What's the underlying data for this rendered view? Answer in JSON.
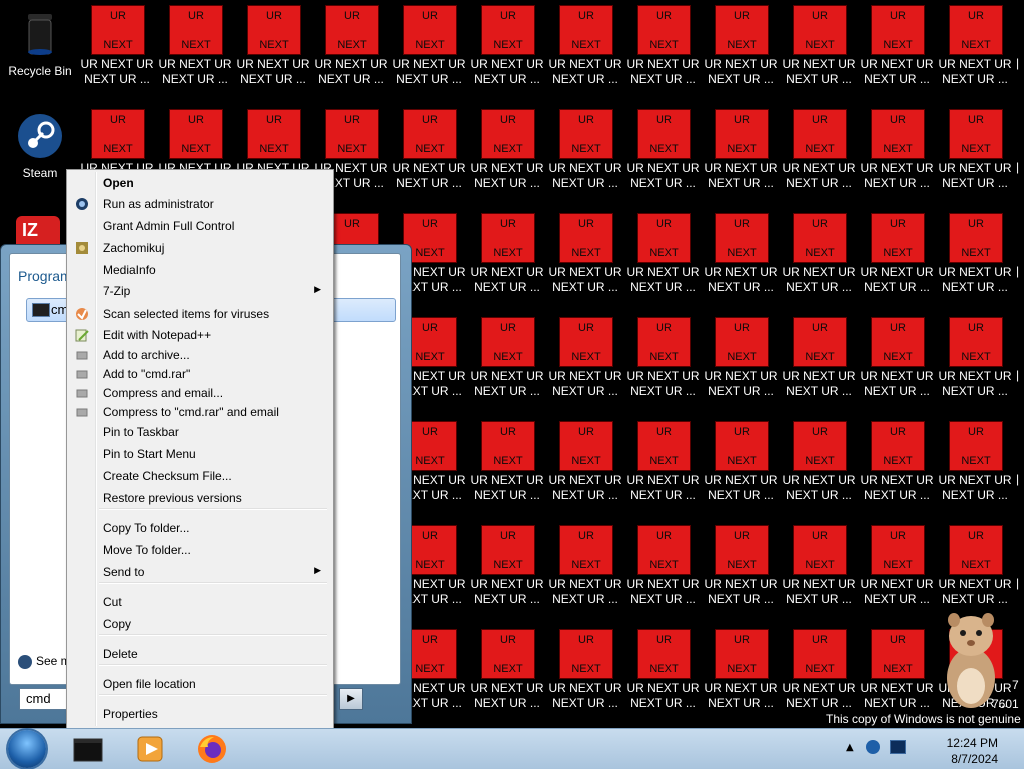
{
  "desktop": {
    "tile_top_text": "UR",
    "tile_bottom_text": "NEXT",
    "tile_caption_line1": "UR NEXT UR",
    "tile_caption_line2": "NEXT UR ...",
    "tile_color": "#e1191a",
    "system_icons": [
      {
        "label": "Recycle Bin",
        "icon": "recycle-bin-icon"
      },
      {
        "label": "Steam",
        "icon": "steam-icon"
      }
    ]
  },
  "start_menu": {
    "programs_label": "Programs",
    "result_label": "cmd",
    "see_more": "See more results",
    "search_value": "cmd"
  },
  "context_menu": {
    "items": [
      {
        "label": "Open",
        "bold": true
      },
      {
        "label": "Run as administrator",
        "icon": "shield-icon"
      },
      {
        "label": "Grant Admin Full Control"
      },
      {
        "label": "Zachomikuj",
        "icon": "hamster-icon"
      },
      {
        "label": "MediaInfo"
      },
      {
        "label": "7-Zip",
        "submenu": true
      },
      {
        "label": "Scan selected items for viruses",
        "icon": "antivirus-icon"
      },
      {
        "label": "Edit with Notepad++",
        "icon": "notepadpp-icon"
      },
      {
        "label": "Add to archive...",
        "icon": "archive-icon"
      },
      {
        "label": "Add to \"cmd.rar\"",
        "icon": "archive-icon"
      },
      {
        "label": "Compress and email...",
        "icon": "archive-icon"
      },
      {
        "label": "Compress to \"cmd.rar\" and email",
        "icon": "archive-icon"
      },
      {
        "label": "Pin to Taskbar"
      },
      {
        "label": "Pin to Start Menu"
      },
      {
        "label": "Create Checksum File..."
      },
      {
        "label": "Restore previous versions"
      },
      {
        "label": "Copy To folder..."
      },
      {
        "label": "Move To folder..."
      },
      {
        "label": "Send to",
        "submenu": true
      },
      {
        "label": "Cut"
      },
      {
        "label": "Copy"
      },
      {
        "label": "Delete"
      },
      {
        "label": "Open file location"
      },
      {
        "label": "Properties"
      }
    ]
  },
  "watermark": {
    "build_line1": "7",
    "build_line2": "7601",
    "genuine": "This copy of Windows is not genuine"
  },
  "taskbar": {
    "apps": [
      "cmd-icon",
      "media-player-icon",
      "firefox-icon"
    ],
    "clock_time": "12:24 PM",
    "clock_date": "8/7/2024"
  }
}
